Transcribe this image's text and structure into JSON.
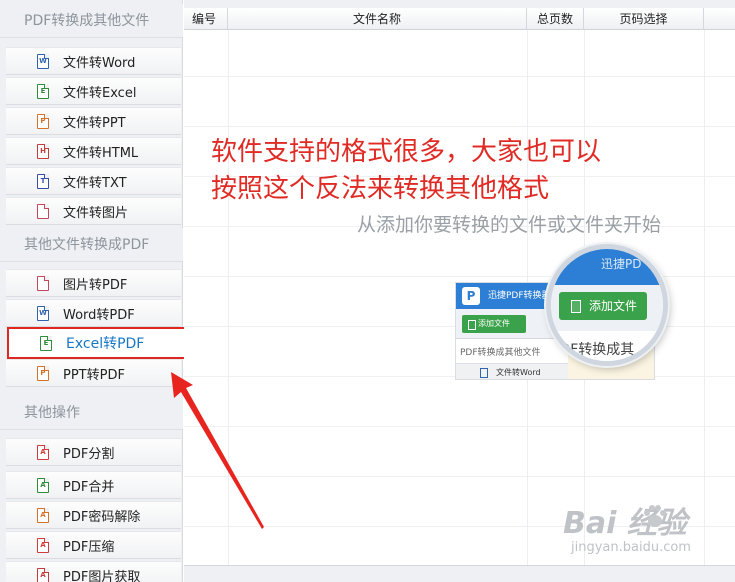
{
  "sidebar": {
    "sections": [
      {
        "title": "PDF转换成其他文件",
        "items": [
          {
            "label": "文件转Word",
            "icon": "word-file-icon",
            "glyph": "W"
          },
          {
            "label": "文件转Excel",
            "icon": "excel-file-icon",
            "glyph": "E"
          },
          {
            "label": "文件转PPT",
            "icon": "ppt-file-icon",
            "glyph": "P"
          },
          {
            "label": "文件转HTML",
            "icon": "html-file-icon",
            "glyph": "H"
          },
          {
            "label": "文件转TXT",
            "icon": "txt-file-icon",
            "glyph": "T"
          },
          {
            "label": "文件转图片",
            "icon": "image-file-icon",
            "glyph": ""
          }
        ]
      },
      {
        "title": "其他文件转换成PDF",
        "items": [
          {
            "label": "图片转PDF",
            "icon": "image-file-icon",
            "glyph": ""
          },
          {
            "label": "Word转PDF",
            "icon": "word-file-icon",
            "glyph": "W"
          },
          {
            "label": "Excel转PDF",
            "icon": "excel-file-icon",
            "glyph": "E",
            "selected": true
          },
          {
            "label": "PPT转PDF",
            "icon": "ppt-file-icon",
            "glyph": "P"
          }
        ]
      },
      {
        "title": "其他操作",
        "items": [
          {
            "label": "PDF分割",
            "icon": "pdf-file-icon",
            "glyph": "A"
          },
          {
            "label": "PDF合并",
            "icon": "pdf-file-icon",
            "glyph": "A"
          },
          {
            "label": "PDF密码解除",
            "icon": "pdf-file-icon",
            "glyph": "A"
          },
          {
            "label": "PDF压缩",
            "icon": "pdf-file-icon",
            "glyph": "A"
          },
          {
            "label": "PDF图片获取",
            "icon": "pdf-file-icon",
            "glyph": "A"
          }
        ]
      }
    ]
  },
  "table": {
    "columns": [
      "编号",
      "文件名称",
      "总页数",
      "页码选择",
      ""
    ]
  },
  "annotation": {
    "line1": "软件支持的格式很多，大家也可以",
    "line2": "按照这个反法来转换其他格式"
  },
  "hint": "从添加你要转换的文件或文件夹开始",
  "inset": {
    "app_title": "迅捷PDF转换器",
    "add_button": "添加文件",
    "section": "PDF转换成其他文件",
    "item": "文件转Word",
    "magnifier_title": "迅捷PD",
    "magnifier_add": "添加文件",
    "magnifier_sub": "PDF转换成其"
  },
  "watermark": {
    "logo": "Bai  经验",
    "url": "jingyan.baidu.com"
  },
  "colors": {
    "annotation": "#e02b25",
    "selection_border": "#e0271f",
    "selected_text": "#1777c4",
    "app_blue": "#2c7fd4",
    "add_green": "#3aa24a"
  }
}
